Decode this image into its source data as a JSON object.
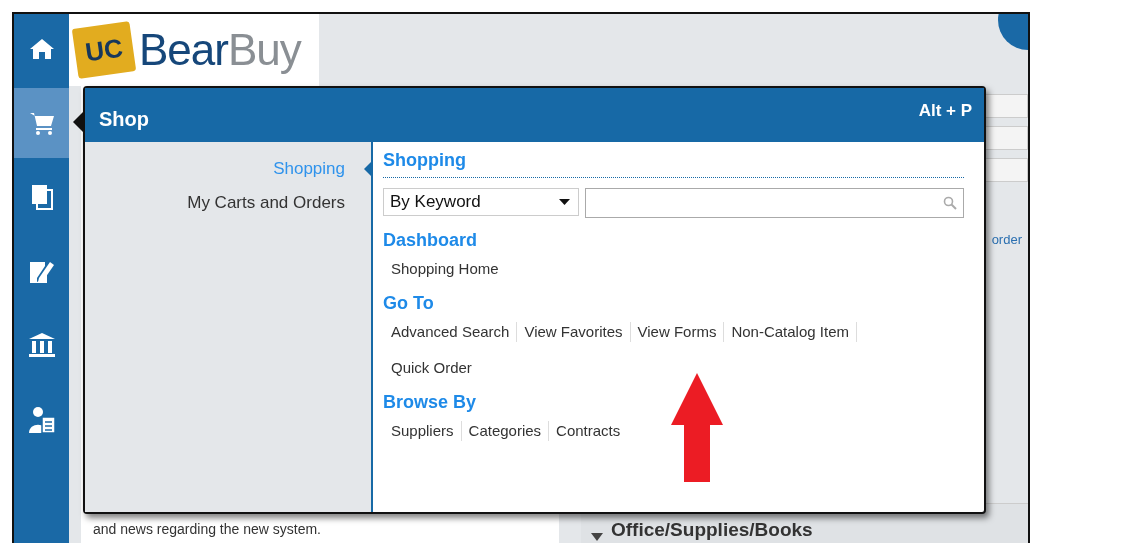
{
  "nav": [
    {
      "selected": false
    },
    {
      "selected": true
    },
    {
      "selected": false
    },
    {
      "selected": false
    },
    {
      "selected": false
    },
    {
      "selected": false
    }
  ],
  "logo": {
    "badge": "UC",
    "bear": "Bear",
    "buy": "Buy"
  },
  "background": {
    "link": "order",
    "note": "and news regarding the new system.",
    "panel_title": "Office/Supplies/Books"
  },
  "popup": {
    "title": "Shop",
    "shortcut": "Alt + P",
    "menu": [
      {
        "label": "Shopping",
        "selected": true
      },
      {
        "label": "My Carts and Orders",
        "selected": false
      }
    ],
    "heading": "Shopping",
    "search": {
      "dropdown": "By Keyword"
    },
    "sections": [
      {
        "title": "Dashboard",
        "links": [
          "Shopping Home"
        ]
      },
      {
        "title": "Go To",
        "links": [
          "Advanced Search",
          "View Favorites",
          "View Forms",
          "Non-Catalog Item",
          "Quick Order"
        ]
      },
      {
        "title": "Browse By",
        "links": [
          "Suppliers",
          "Categories",
          "Contracts"
        ]
      }
    ]
  }
}
